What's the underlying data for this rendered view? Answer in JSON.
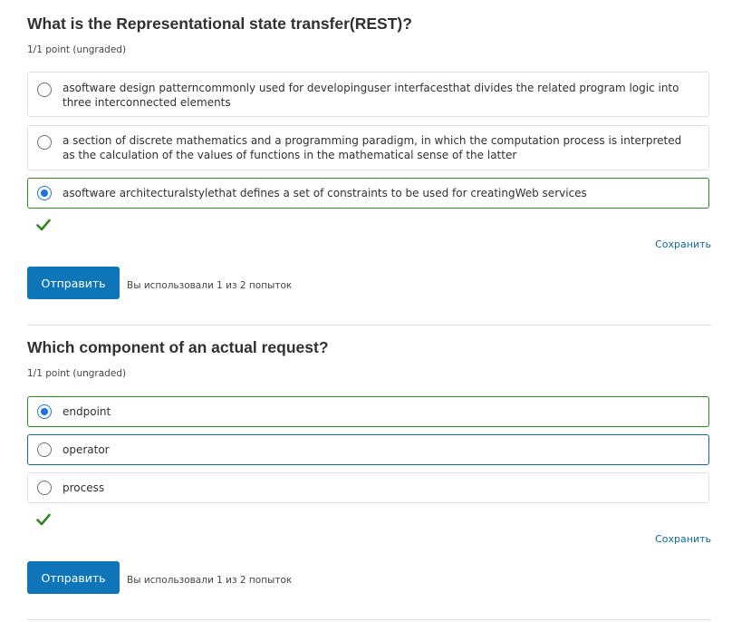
{
  "questions": [
    {
      "title": "What is the Representational state transfer(REST)?",
      "points": "1/1 point (ungraded)",
      "choices": [
        {
          "label": "asoftware design patterncommonly used for developinguser interfacesthat divides the related program logic into three interconnected elements",
          "selected": false
        },
        {
          "label": "a section of discrete mathematics and a programming paradigm, in which the computation process is interpreted as the calculation of the values of functions in the mathematical sense of the latter",
          "selected": false
        },
        {
          "label": "asoftware architecturalstylethat defines a set of constraints to be used for creatingWeb services",
          "selected": true
        }
      ],
      "status_icon": "checkmark-icon",
      "save_label": "Сохранить",
      "submit_label": "Отправить",
      "attempts_text": "Вы использовали 1 из 2 попыток"
    },
    {
      "title": "Which component of an actual request?",
      "points": "1/1 point (ungraded)",
      "choices": [
        {
          "label": "endpoint",
          "selected": true
        },
        {
          "label": "operator",
          "selected": false
        },
        {
          "label": "process",
          "selected": false
        }
      ],
      "status_icon": "checkmark-icon",
      "save_label": "Сохранить",
      "submit_label": "Отправить",
      "attempts_text": "Вы использовали 1 из 2 попыток"
    }
  ],
  "colors": {
    "correct_border": "#2f8a1e",
    "focus_border": "#0e6b9e",
    "primary_button": "#0e75b8",
    "link": "#0a6aa1",
    "radio_checked": "#1a73e8",
    "check": "#2f8a1e"
  }
}
